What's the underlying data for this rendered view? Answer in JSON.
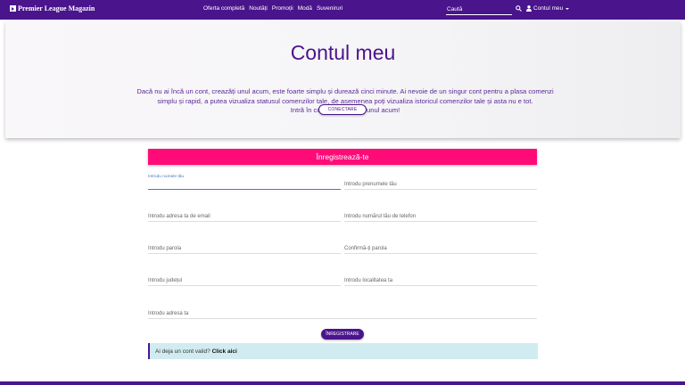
{
  "nav": {
    "brand": "Premier League Magazin",
    "links": [
      "Oferta completă",
      "Noutăți",
      "Promoții",
      "Modă",
      "Suveniruri"
    ],
    "search_placeholder": "Caută",
    "account_label": "Contul meu"
  },
  "hero": {
    "title": "Contul meu",
    "line1": "Dacă nu ai încă un cont, creazăți unul acum, este foarte simplu și durează cinci minute. Ai nevoie de un singur cont pentru a plasa comenzi",
    "line2": "simplu și rapid, a putea vizualiza statusul comenzilor tale, de asemenea poți vizualiza istoricul comenzilor tale și asta nu e tot.",
    "line3": "Intră în cont sau creazăți unul acum!",
    "button": "CONECTARE"
  },
  "form": {
    "header": "Înregistrează-te",
    "fields": {
      "nume": "Introdu numele tău",
      "prenume": "Introdu prenumele tău",
      "email": "Introdu adresa ta de email",
      "telefon": "Introdu numărul tău de telefon",
      "parola": "Introdu parola",
      "confirm": "Confirmă-ți parola",
      "judet": "Introdu județul",
      "localitate": "Introdu localitatea ta",
      "adresa": "Introdu adresa ta"
    },
    "submit": "ÎNREGISTRARE",
    "alert_text": "Ai deja un cont valid?",
    "alert_link": "Click aici"
  },
  "colors": {
    "primary": "#4a148c",
    "accent": "#ff0b78",
    "alert_bg": "#d1ecf1"
  }
}
